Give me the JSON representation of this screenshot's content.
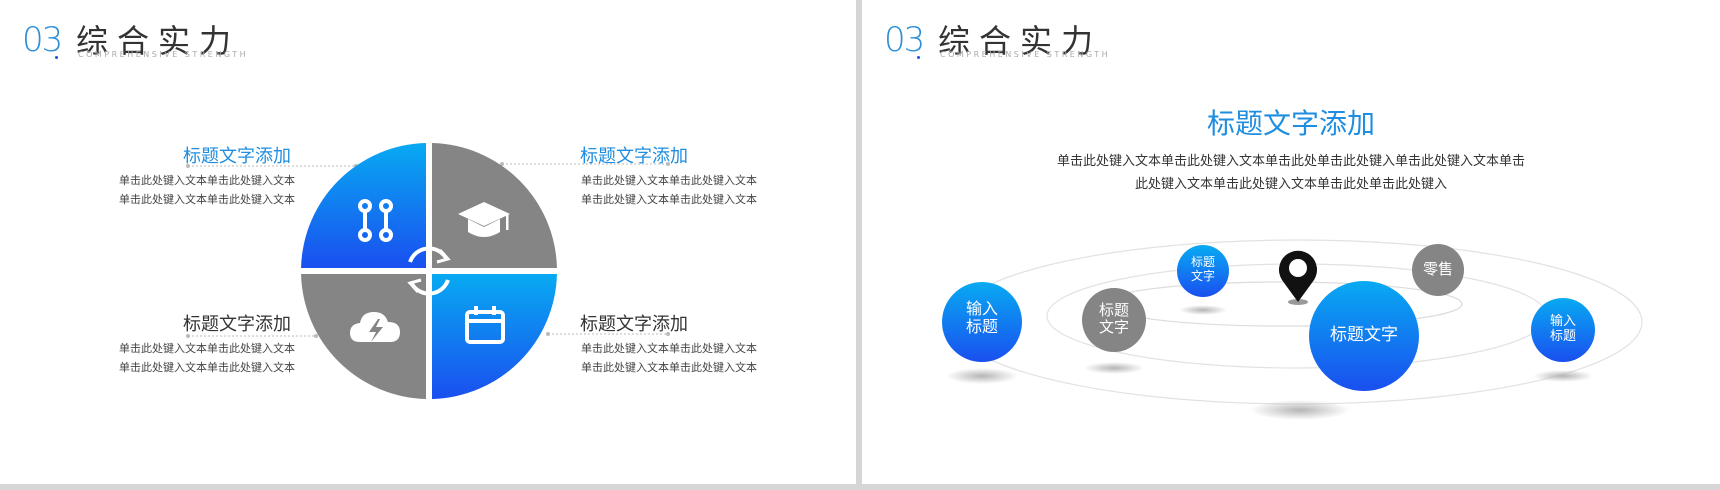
{
  "left_slide": {
    "header": {
      "number": "03",
      "title": "综合实力",
      "subtitle": "COMPREHENSIVE STRENGTH"
    },
    "quadrants": [
      {
        "title": "标题文字添加",
        "title_color": "#1f8ee0",
        "lines": [
          "单击此处键入文本单击此处键入文本",
          "单击此处键入文本单击此处键入文本"
        ],
        "icon": "tool-icon"
      },
      {
        "title": "标题文字添加",
        "title_color": "#1f8ee0",
        "lines": [
          "单击此处键入文本单击此处键入文本",
          "单击此处键入文本单击此处键入文本"
        ],
        "icon": "graduation-cap-icon"
      },
      {
        "title": "标题文字添加",
        "title_color": "#333333",
        "lines": [
          "单击此处键入文本单击此处键入文本",
          "单击此处键入文本单击此处键入文本"
        ],
        "icon": "cloud-lightning-icon"
      },
      {
        "title": "标题文字添加",
        "title_color": "#333333",
        "lines": [
          "单击此处键入文本单击此处键入文本",
          "单击此处键入文本单击此处键入文本"
        ],
        "icon": "calendar-icon"
      }
    ],
    "center_icon": "refresh-icon"
  },
  "right_slide": {
    "header": {
      "number": "03",
      "title": "综合实力",
      "subtitle": "COMPREHENSIVE STRENGTH"
    },
    "title": "标题文字添加",
    "body_line1": "单击此处键入文本单击此处键入文本单击此处单击此处键入单击此处键入文本单击",
    "body_line2": "此处键入文本单击此处键入文本单击此处单击此处键入",
    "bubbles": {
      "input_title": [
        "输入",
        "标题"
      ],
      "title_text_small": [
        "标题",
        "文字"
      ],
      "title_text_gray": [
        "标题",
        "文字"
      ],
      "retail": "零售",
      "title_text_big": "标题文字",
      "input_title_right": [
        "输入",
        "标题"
      ]
    },
    "pin_icon": "map-pin-icon"
  },
  "colors": {
    "accent": "#1f8ee0",
    "blue_dark": "#1a4fef",
    "blue_light": "#08aaf2",
    "gray": "#858585"
  }
}
